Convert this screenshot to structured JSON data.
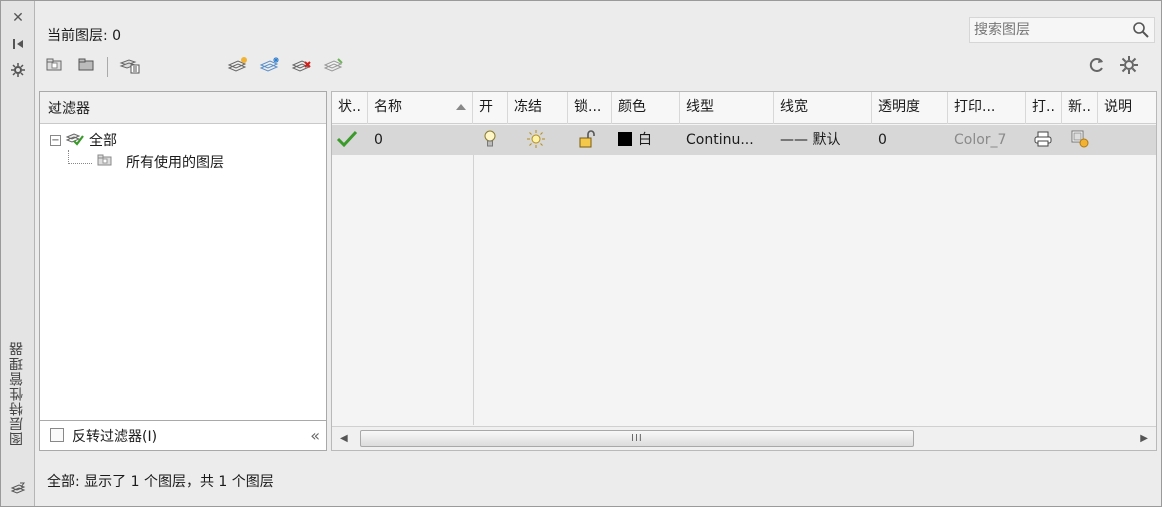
{
  "strip": {
    "title": "图层特性管理器"
  },
  "header": {
    "current_layer": "当前图层: 0"
  },
  "search": {
    "placeholder": "搜索图层"
  },
  "filters": {
    "title": "过滤器",
    "tree": {
      "all": "全部",
      "used": "所有使用的图层"
    },
    "invert_label": "反转过滤器(I)"
  },
  "table": {
    "columns": [
      "状..",
      "名称",
      "开",
      "冻结",
      "锁...",
      "颜色",
      "线型",
      "线宽",
      "透明度",
      "打印...",
      "打..",
      "新..",
      "说明"
    ],
    "row": {
      "name": "0",
      "color": "白",
      "linetype": "Continu...",
      "lineweight": "—— 默认",
      "transparency": "0",
      "plotstyle": "Color_7"
    },
    "scroll_grip": "III"
  },
  "status": {
    "text": "全部: 显示了 1 个图层，共 1 个图层"
  },
  "colors": {
    "accent_green": "#3a9a2a",
    "selected_row": "#d7d7d7",
    "bulb_yellow": "#e6c23a"
  }
}
